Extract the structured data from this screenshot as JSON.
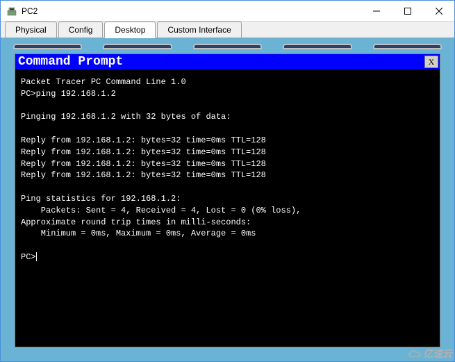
{
  "window": {
    "title": "PC2"
  },
  "tabs": {
    "physical": "Physical",
    "config": "Config",
    "desktop": "Desktop",
    "custom": "Custom Interface"
  },
  "cmd": {
    "title": "Command Prompt",
    "close_label": "X",
    "lines": {
      "l0": "Packet Tracer PC Command Line 1.0",
      "l1": "PC>ping 192.168.1.2",
      "l2": "",
      "l3": "Pinging 192.168.1.2 with 32 bytes of data:",
      "l4": "",
      "l5": "Reply from 192.168.1.2: bytes=32 time=0ms TTL=128",
      "l6": "Reply from 192.168.1.2: bytes=32 time=0ms TTL=128",
      "l7": "Reply from 192.168.1.2: bytes=32 time=0ms TTL=128",
      "l8": "Reply from 192.168.1.2: bytes=32 time=0ms TTL=128",
      "l9": "",
      "l10": "Ping statistics for 192.168.1.2:",
      "l11": "    Packets: Sent = 4, Received = 4, Lost = 0 (0% loss),",
      "l12": "Approximate round trip times in milli-seconds:",
      "l13": "    Minimum = 0ms, Maximum = 0ms, Average = 0ms",
      "l14": "",
      "l15": "PC>"
    }
  },
  "watermark": "亿速云"
}
